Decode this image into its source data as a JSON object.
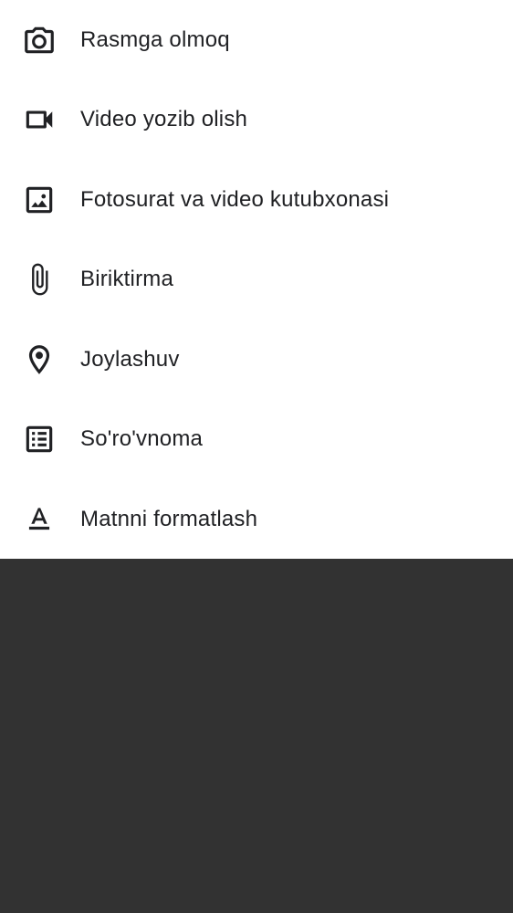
{
  "menu": {
    "items": [
      {
        "label": "Rasmga olmoq",
        "icon": "camera-icon"
      },
      {
        "label": "Video yozib olish",
        "icon": "videocam-icon"
      },
      {
        "label": "Fotosurat va video kutubxonasi",
        "icon": "image-icon"
      },
      {
        "label": "Biriktirma",
        "icon": "attachment-icon"
      },
      {
        "label": "Joylashuv",
        "icon": "location-pin-icon"
      },
      {
        "label": "So'ro'vnoma",
        "icon": "poll-icon"
      },
      {
        "label": "Matnni formatlash",
        "icon": "text-format-icon"
      }
    ]
  },
  "colors": {
    "sheet_background": "#ffffff",
    "scrim": "#323232",
    "text": "#202124",
    "icon": "#202124"
  }
}
